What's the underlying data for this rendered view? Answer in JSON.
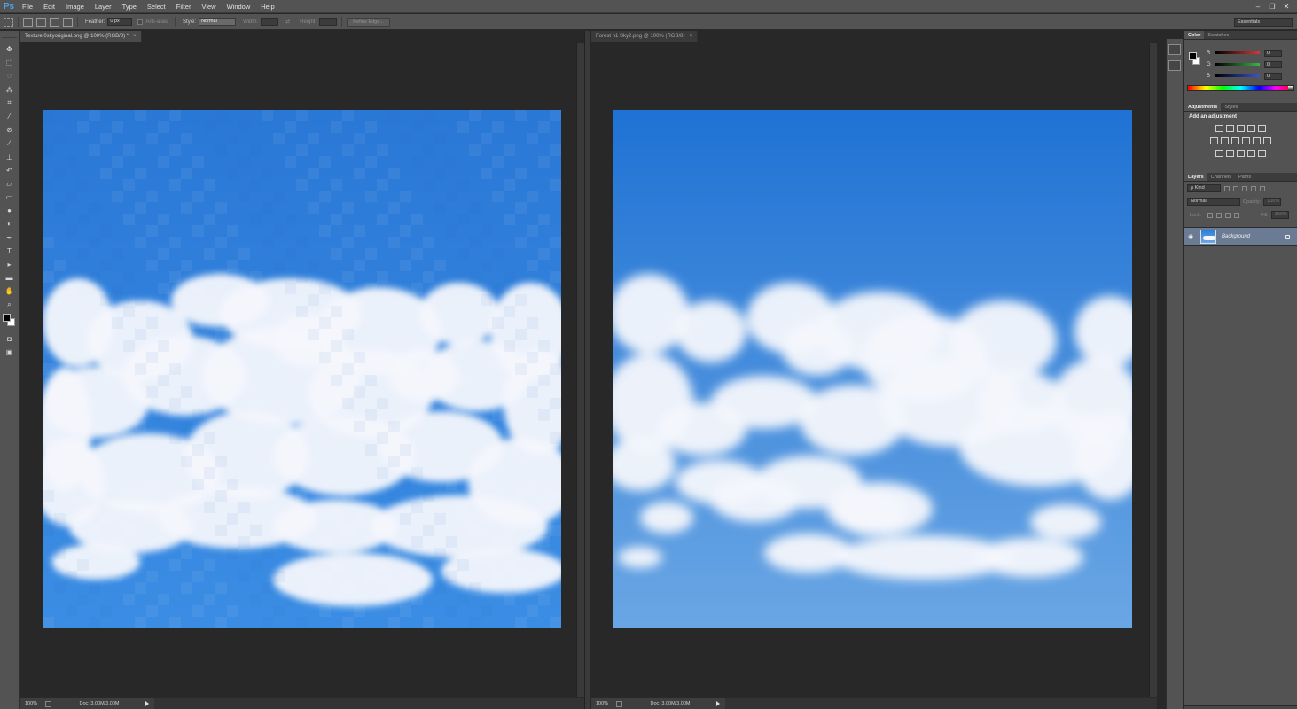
{
  "app": {
    "logo": "Ps"
  },
  "menu": [
    "File",
    "Edit",
    "Image",
    "Layer",
    "Type",
    "Select",
    "Filter",
    "View",
    "Window",
    "Help"
  ],
  "window_controls": [
    "–",
    "❐",
    "✕"
  ],
  "options_bar": {
    "feather_label": "Feather:",
    "feather_value": "0 px",
    "anti_alias_label": "Anti-alias",
    "style_label": "Style:",
    "style_value": "Normal",
    "width_label": "Width:",
    "height_label": "Height:",
    "refine_edge_label": "Refine Edge...",
    "workspace": "Essentials"
  },
  "documents": [
    {
      "tab_title": "Texture 0skyoriginal.png @ 100% (RGB/8) *",
      "zoom": "100%",
      "doc_info": "Doc: 3.00M/3.00M",
      "sky_top": "#2a78d6",
      "sky_bottom": "#3b8de4",
      "pixelated": true
    },
    {
      "tab_title": "Forest n1 Sky2.png @ 100% (RGB/8)",
      "zoom": "100%",
      "doc_info": "Doc: 3.00M/3.00M",
      "sky_top": "#1f72d4",
      "sky_bottom": "#6aa6e4",
      "pixelated": false
    }
  ],
  "color_panel": {
    "tabs": [
      "Color",
      "Swatches"
    ],
    "channels": [
      {
        "label": "R",
        "value": "0",
        "color": "#d23b3b"
      },
      {
        "label": "G",
        "value": "0",
        "color": "#3bb44a"
      },
      {
        "label": "B",
        "value": "0",
        "color": "#3b53d2"
      }
    ]
  },
  "adjustments_panel": {
    "tabs": [
      "Adjustments",
      "Styles"
    ],
    "title": "Add an adjustment"
  },
  "layers_panel": {
    "tabs": [
      "Layers",
      "Channels",
      "Paths"
    ],
    "kind_label": "ρ Kind",
    "blend_mode": "Normal",
    "opacity_label": "Opacity:",
    "opacity_value": "100%",
    "lock_label": "Lock:",
    "fill_label": "Fill:",
    "fill_value": "100%",
    "layers": [
      {
        "name": "Background",
        "visible": true,
        "locked": true
      }
    ]
  },
  "tools": [
    "move",
    "marquee",
    "lasso",
    "quick-select",
    "crop",
    "eyedropper",
    "healing",
    "brush",
    "clone-stamp",
    "history-brush",
    "eraser",
    "gradient",
    "blur",
    "dodge",
    "pen",
    "type",
    "path-select",
    "shape",
    "hand",
    "zoom"
  ]
}
